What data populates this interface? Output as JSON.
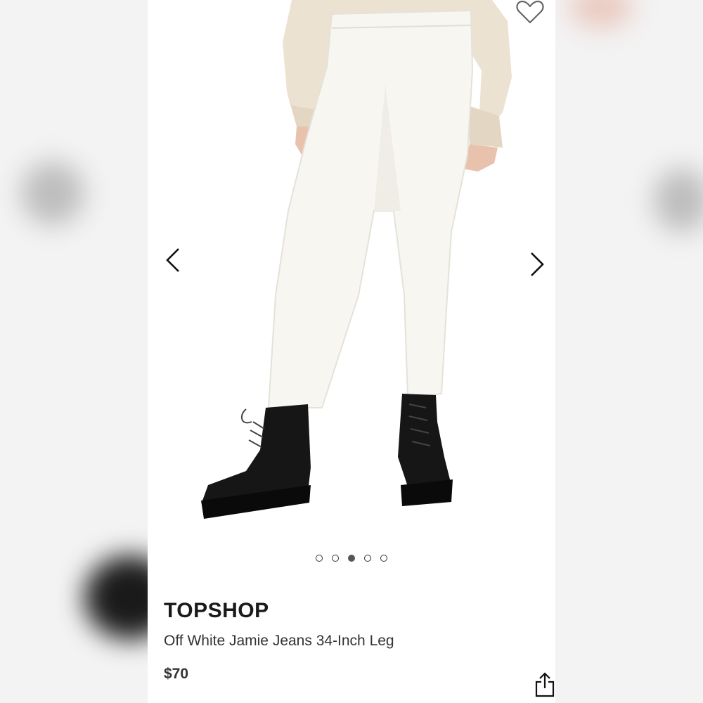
{
  "product": {
    "brand": "TOPSHOP",
    "name": "Off White Jamie Jeans 34-Inch Leg",
    "price": "$70"
  },
  "gallery": {
    "image_count": 5,
    "active_index": 2,
    "image_subject": "model wearing off-white skinny jeans, cream knit sweater and black lace-up platform boots"
  },
  "icons": {
    "favorite": "heart-outline-icon",
    "previous": "chevron-left-icon",
    "next": "chevron-right-icon",
    "share": "share-icon"
  },
  "colors": {
    "text": "#1a1a1a",
    "secondary_text": "#333333",
    "background": "#ffffff"
  }
}
